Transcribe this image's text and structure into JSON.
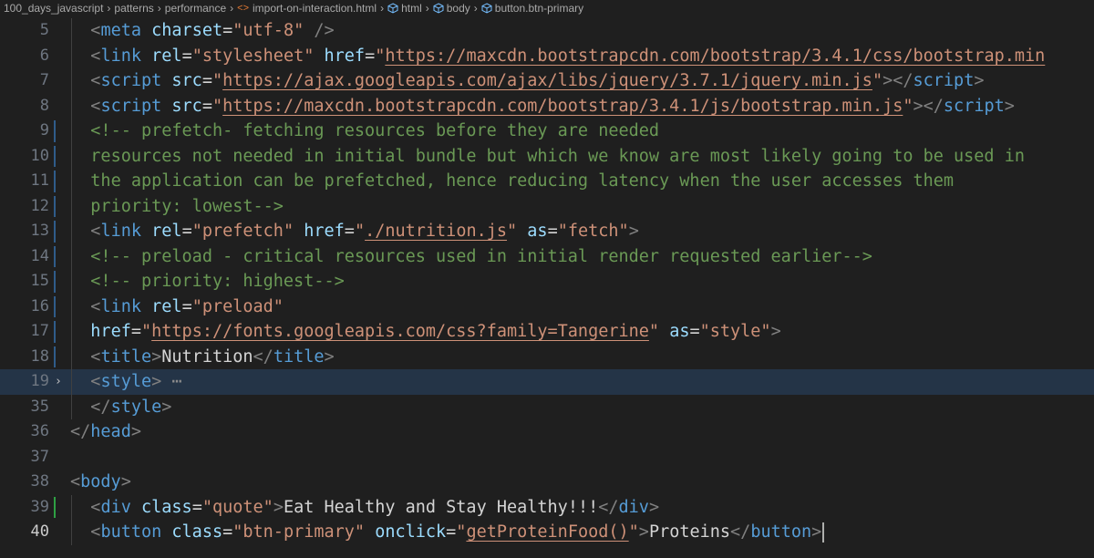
{
  "breadcrumb": {
    "items": [
      "100_days_javascript",
      "patterns",
      "performance",
      "import-on-interaction.html",
      "html",
      "body",
      "button.btn-primary"
    ],
    "file_icon": "html-file-icon",
    "element_icon": "cube-icon"
  },
  "editor": {
    "current_line": 19,
    "lines": [
      {
        "n": "5",
        "indent": 2,
        "tokens": [
          [
            "br",
            "<"
          ],
          [
            "tag",
            "meta"
          ],
          [
            "txt",
            " "
          ],
          [
            "attr",
            "charset"
          ],
          [
            "eq",
            "="
          ],
          [
            "str",
            "\"utf-8\""
          ],
          [
            "txt",
            " "
          ],
          [
            "br",
            "/>"
          ]
        ]
      },
      {
        "n": "6",
        "indent": 2,
        "tokens": [
          [
            "br",
            "<"
          ],
          [
            "tag",
            "link"
          ],
          [
            "txt",
            " "
          ],
          [
            "attr",
            "rel"
          ],
          [
            "eq",
            "="
          ],
          [
            "str",
            "\"stylesheet\""
          ],
          [
            "txt",
            " "
          ],
          [
            "attr",
            "href"
          ],
          [
            "eq",
            "="
          ],
          [
            "str",
            "\""
          ],
          [
            "url",
            "https://maxcdn.bootstrapcdn.com/bootstrap/3.4.1/css/bootstrap.min"
          ]
        ]
      },
      {
        "n": "7",
        "indent": 2,
        "tokens": [
          [
            "br",
            "<"
          ],
          [
            "tag",
            "script"
          ],
          [
            "txt",
            " "
          ],
          [
            "attr",
            "src"
          ],
          [
            "eq",
            "="
          ],
          [
            "str",
            "\""
          ],
          [
            "url",
            "https://ajax.googleapis.com/ajax/libs/jquery/3.7.1/jquery.min.js"
          ],
          [
            "str",
            "\""
          ],
          [
            "br",
            "></"
          ],
          [
            "tag",
            "script"
          ],
          [
            "br",
            ">"
          ]
        ]
      },
      {
        "n": "8",
        "indent": 2,
        "tokens": [
          [
            "br",
            "<"
          ],
          [
            "tag",
            "script"
          ],
          [
            "txt",
            " "
          ],
          [
            "attr",
            "src"
          ],
          [
            "eq",
            "="
          ],
          [
            "str",
            "\""
          ],
          [
            "url",
            "https://maxcdn.bootstrapcdn.com/bootstrap/3.4.1/js/bootstrap.min.js"
          ],
          [
            "str",
            "\""
          ],
          [
            "br",
            "></"
          ],
          [
            "tag",
            "script"
          ],
          [
            "br",
            ">"
          ]
        ]
      },
      {
        "n": "9",
        "indent": 2,
        "mark": "mod",
        "tokens": [
          [
            "com",
            "<!-- prefetch- fetching resources before they are needed"
          ]
        ]
      },
      {
        "n": "10",
        "indent": 2,
        "mark": "mod",
        "tokens": [
          [
            "com",
            "resources not needed in initial bundle but which we know are most likely going to be used in"
          ]
        ]
      },
      {
        "n": "11",
        "indent": 2,
        "mark": "mod",
        "tokens": [
          [
            "com",
            "the application can be prefetched, hence reducing latency when the user accesses them"
          ]
        ]
      },
      {
        "n": "12",
        "indent": 2,
        "mark": "mod",
        "tokens": [
          [
            "com",
            "priority: lowest-->"
          ]
        ]
      },
      {
        "n": "13",
        "indent": 2,
        "mark": "mod",
        "tokens": [
          [
            "br",
            "<"
          ],
          [
            "tag",
            "link"
          ],
          [
            "txt",
            " "
          ],
          [
            "attr",
            "rel"
          ],
          [
            "eq",
            "="
          ],
          [
            "str",
            "\"prefetch\""
          ],
          [
            "txt",
            " "
          ],
          [
            "attr",
            "href"
          ],
          [
            "eq",
            "="
          ],
          [
            "str",
            "\""
          ],
          [
            "url",
            "./nutrition.js"
          ],
          [
            "str",
            "\""
          ],
          [
            "txt",
            " "
          ],
          [
            "attr",
            "as"
          ],
          [
            "eq",
            "="
          ],
          [
            "str",
            "\"fetch\""
          ],
          [
            "br",
            ">"
          ]
        ]
      },
      {
        "n": "14",
        "indent": 2,
        "mark": "mod",
        "tokens": [
          [
            "com",
            "<!-- preload - critical resources used in initial render requested earlier-->"
          ]
        ]
      },
      {
        "n": "15",
        "indent": 2,
        "mark": "mod",
        "tokens": [
          [
            "com",
            "<!-- priority: highest-->"
          ]
        ]
      },
      {
        "n": "16",
        "indent": 2,
        "mark": "mod",
        "tokens": [
          [
            "br",
            "<"
          ],
          [
            "tag",
            "link"
          ],
          [
            "txt",
            " "
          ],
          [
            "attr",
            "rel"
          ],
          [
            "eq",
            "="
          ],
          [
            "str",
            "\"preload\""
          ]
        ]
      },
      {
        "n": "17",
        "indent": 2,
        "mark": "mod",
        "tokens": [
          [
            "attr",
            "href"
          ],
          [
            "eq",
            "="
          ],
          [
            "str",
            "\""
          ],
          [
            "url",
            "https://fonts.googleapis.com/css?family=Tangerine"
          ],
          [
            "str",
            "\""
          ],
          [
            "txt",
            " "
          ],
          [
            "attr",
            "as"
          ],
          [
            "eq",
            "="
          ],
          [
            "str",
            "\"style\""
          ],
          [
            "br",
            ">"
          ]
        ]
      },
      {
        "n": "18",
        "indent": 2,
        "mark": "mod",
        "tokens": [
          [
            "br",
            "<"
          ],
          [
            "tag",
            "title"
          ],
          [
            "br",
            ">"
          ],
          [
            "txt",
            "Nutrition"
          ],
          [
            "br",
            "</"
          ],
          [
            "tag",
            "title"
          ],
          [
            "br",
            ">"
          ]
        ]
      },
      {
        "n": "19",
        "indent": 2,
        "fold": "›",
        "tokens": [
          [
            "br",
            "<"
          ],
          [
            "tag",
            "style"
          ],
          [
            "br",
            ">"
          ],
          [
            "fold",
            " ⋯"
          ]
        ]
      },
      {
        "n": "35",
        "indent": 2,
        "tokens": [
          [
            "br",
            "</"
          ],
          [
            "tag",
            "style"
          ],
          [
            "br",
            ">"
          ]
        ]
      },
      {
        "n": "36",
        "indent": 0,
        "tokens": [
          [
            "br",
            "</"
          ],
          [
            "tag",
            "head"
          ],
          [
            "br",
            ">"
          ]
        ]
      },
      {
        "n": "37",
        "indent": 0,
        "tokens": []
      },
      {
        "n": "38",
        "indent": 0,
        "tokens": [
          [
            "br",
            "<"
          ],
          [
            "tag",
            "body"
          ],
          [
            "br",
            ">"
          ]
        ]
      },
      {
        "n": "39",
        "indent": 2,
        "mark": "add",
        "tokens": [
          [
            "br",
            "<"
          ],
          [
            "tag",
            "div"
          ],
          [
            "txt",
            " "
          ],
          [
            "attr",
            "class"
          ],
          [
            "eq",
            "="
          ],
          [
            "str",
            "\"quote\""
          ],
          [
            "br",
            ">"
          ],
          [
            "txt",
            "Eat Healthy and Stay Healthy!!!"
          ],
          [
            "br",
            "</"
          ],
          [
            "tag",
            "div"
          ],
          [
            "br",
            ">"
          ]
        ]
      },
      {
        "n": "40",
        "indent": 2,
        "active": true,
        "cursor": true,
        "tokens": [
          [
            "br",
            "<"
          ],
          [
            "tag",
            "button"
          ],
          [
            "txt",
            " "
          ],
          [
            "attr",
            "class"
          ],
          [
            "eq",
            "="
          ],
          [
            "str",
            "\"btn-primary\""
          ],
          [
            "txt",
            " "
          ],
          [
            "attr",
            "onclick"
          ],
          [
            "eq",
            "="
          ],
          [
            "str",
            "\""
          ],
          [
            "url",
            "getProteinFood()"
          ],
          [
            "str",
            "\""
          ],
          [
            "br",
            ">"
          ],
          [
            "txt",
            "Proteins"
          ],
          [
            "br",
            "</"
          ],
          [
            "tag",
            "button"
          ],
          [
            "br",
            ">"
          ]
        ]
      }
    ]
  }
}
